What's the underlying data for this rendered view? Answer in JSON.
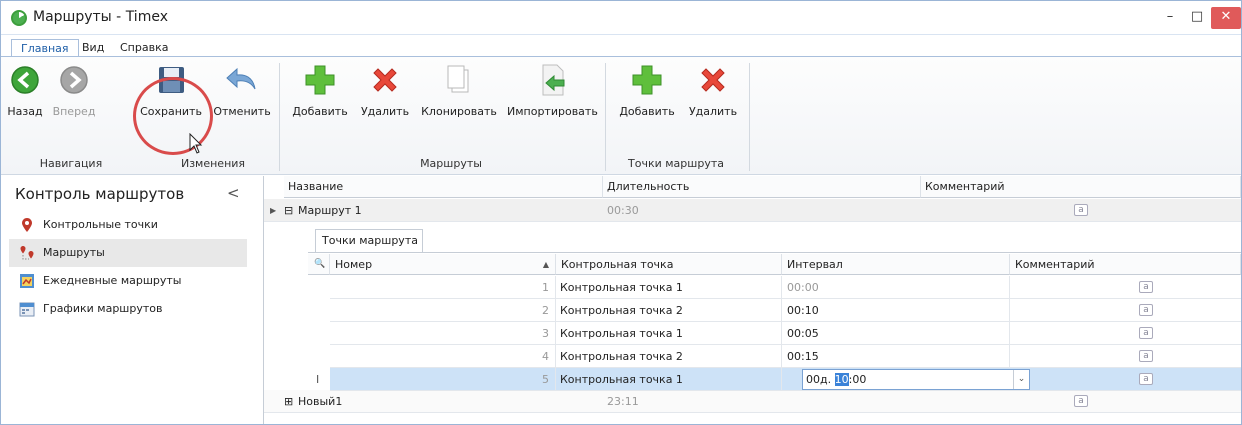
{
  "window": {
    "title": "Маршруты - Timex",
    "min": "–",
    "max": "□",
    "close": "✕"
  },
  "menu": [
    "Главная",
    "Вид",
    "Справка"
  ],
  "ribbon": {
    "buttons": {
      "back": "Назад",
      "forward": "Вперед",
      "save": "Сохранить",
      "cancel": "Отменить",
      "add_route": "Добавить",
      "delete_route": "Удалить",
      "clone": "Клонировать",
      "import": "Импортировать",
      "add_point": "Добавить",
      "delete_point": "Удалить"
    },
    "groups": {
      "navigation": "Навигация",
      "changes": "Изменения",
      "routes": "Маршруты",
      "points": "Точки маршрута"
    }
  },
  "sidebar": {
    "title": "Контроль маршрутов",
    "collapse": "<",
    "items": [
      {
        "label": "Контрольные точки",
        "selected": false
      },
      {
        "label": "Маршруты",
        "selected": true
      },
      {
        "label": "Ежедневные маршруты",
        "selected": false
      },
      {
        "label": "Графики маршрутов",
        "selected": false
      }
    ]
  },
  "grid": {
    "columns": [
      "Название",
      "Длительность",
      "Комментарий"
    ],
    "rows": [
      {
        "expander": "⊟",
        "name": "Маршрут 1",
        "duration": "00:30",
        "comment_icon": "a"
      },
      {
        "expander": "⊞",
        "name": "Новый1",
        "duration": "23:11",
        "comment_icon": "a"
      }
    ],
    "detail": {
      "tab": "Точки маршрута",
      "columns": [
        "Номер",
        "Контрольная точка",
        "Интервал",
        "Комментарий"
      ],
      "rows": [
        {
          "num": "1",
          "point": "Контрольная точка 1",
          "interval": "00:00",
          "comment_icon": "a"
        },
        {
          "num": "2",
          "point": "Контрольная точка 2",
          "interval": "00:10",
          "comment_icon": "a"
        },
        {
          "num": "3",
          "point": "Контрольная точка 1",
          "interval": "00:05",
          "comment_icon": "a"
        },
        {
          "num": "4",
          "point": "Контрольная точка 2",
          "interval": "00:15",
          "comment_icon": "a"
        },
        {
          "num": "5",
          "point": "Контрольная точка 1",
          "interval": "",
          "comment_icon": "a"
        }
      ],
      "editor": {
        "prefix": "00д. ",
        "selected": "10",
        "suffix": ":00",
        "dropdown": "⌄"
      },
      "sort_indicator": "▲",
      "search_icon": "🔍",
      "edit_cursor": "I"
    }
  },
  "colors": {
    "accent": "#1f5fa8",
    "selection": "#cde2f7",
    "callout": "#d94b4b",
    "close": "#e05a5a"
  },
  "icons": [
    "back-icon",
    "forward-icon",
    "save-icon",
    "undo-icon",
    "add-icon",
    "delete-icon",
    "clone-icon",
    "import-icon"
  ]
}
